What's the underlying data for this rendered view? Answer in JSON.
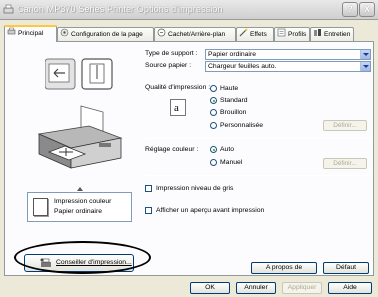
{
  "window": {
    "title": "Canon MP370 Series Printer Options d'impression",
    "help_label": "?",
    "close_label": "X"
  },
  "tabs": [
    {
      "label": "Principal",
      "icon": "principal-icon",
      "active": true
    },
    {
      "label": "Configuration de la page",
      "icon": "page-setup-icon"
    },
    {
      "label": "Cachet/Arrière-plan",
      "icon": "stamp-icon"
    },
    {
      "label": "Effets",
      "icon": "effects-icon"
    },
    {
      "label": "Profils",
      "icon": "profiles-icon"
    },
    {
      "label": "Entretien",
      "icon": "maintenance-icon"
    }
  ],
  "preview": {
    "media_line1": "Impression couleur",
    "media_line2": "Papier ordinaire"
  },
  "conseil_button": {
    "label": "Conseiller d'impression..."
  },
  "settings": {
    "media_type_label": "Type de support :",
    "media_type_value": "Papier ordinaire",
    "paper_source_label": "Source papier :",
    "paper_source_value": "Chargeur feuilles auto.",
    "quality_label": "Qualité d'impression :",
    "quality_options": [
      "Haute",
      "Standard",
      "Brouillon",
      "Personnalisée"
    ],
    "quality_selected": "Standard",
    "quality_define_label": "Définir...",
    "color_label": "Réglage couleur :",
    "color_options": [
      "Auto",
      "Manuel"
    ],
    "color_selected": "Auto",
    "color_define_label": "Définir...",
    "grayscale_label": "Impression niveau de gris",
    "preview_label": "Afficher un aperçu avant impression"
  },
  "panel_buttons": {
    "about_label": "A propos de",
    "default_label": "Défaut"
  },
  "dialog_buttons": {
    "ok_label": "OK",
    "cancel_label": "Annuler",
    "apply_label": "Appliquer",
    "help_label": "Aide"
  }
}
